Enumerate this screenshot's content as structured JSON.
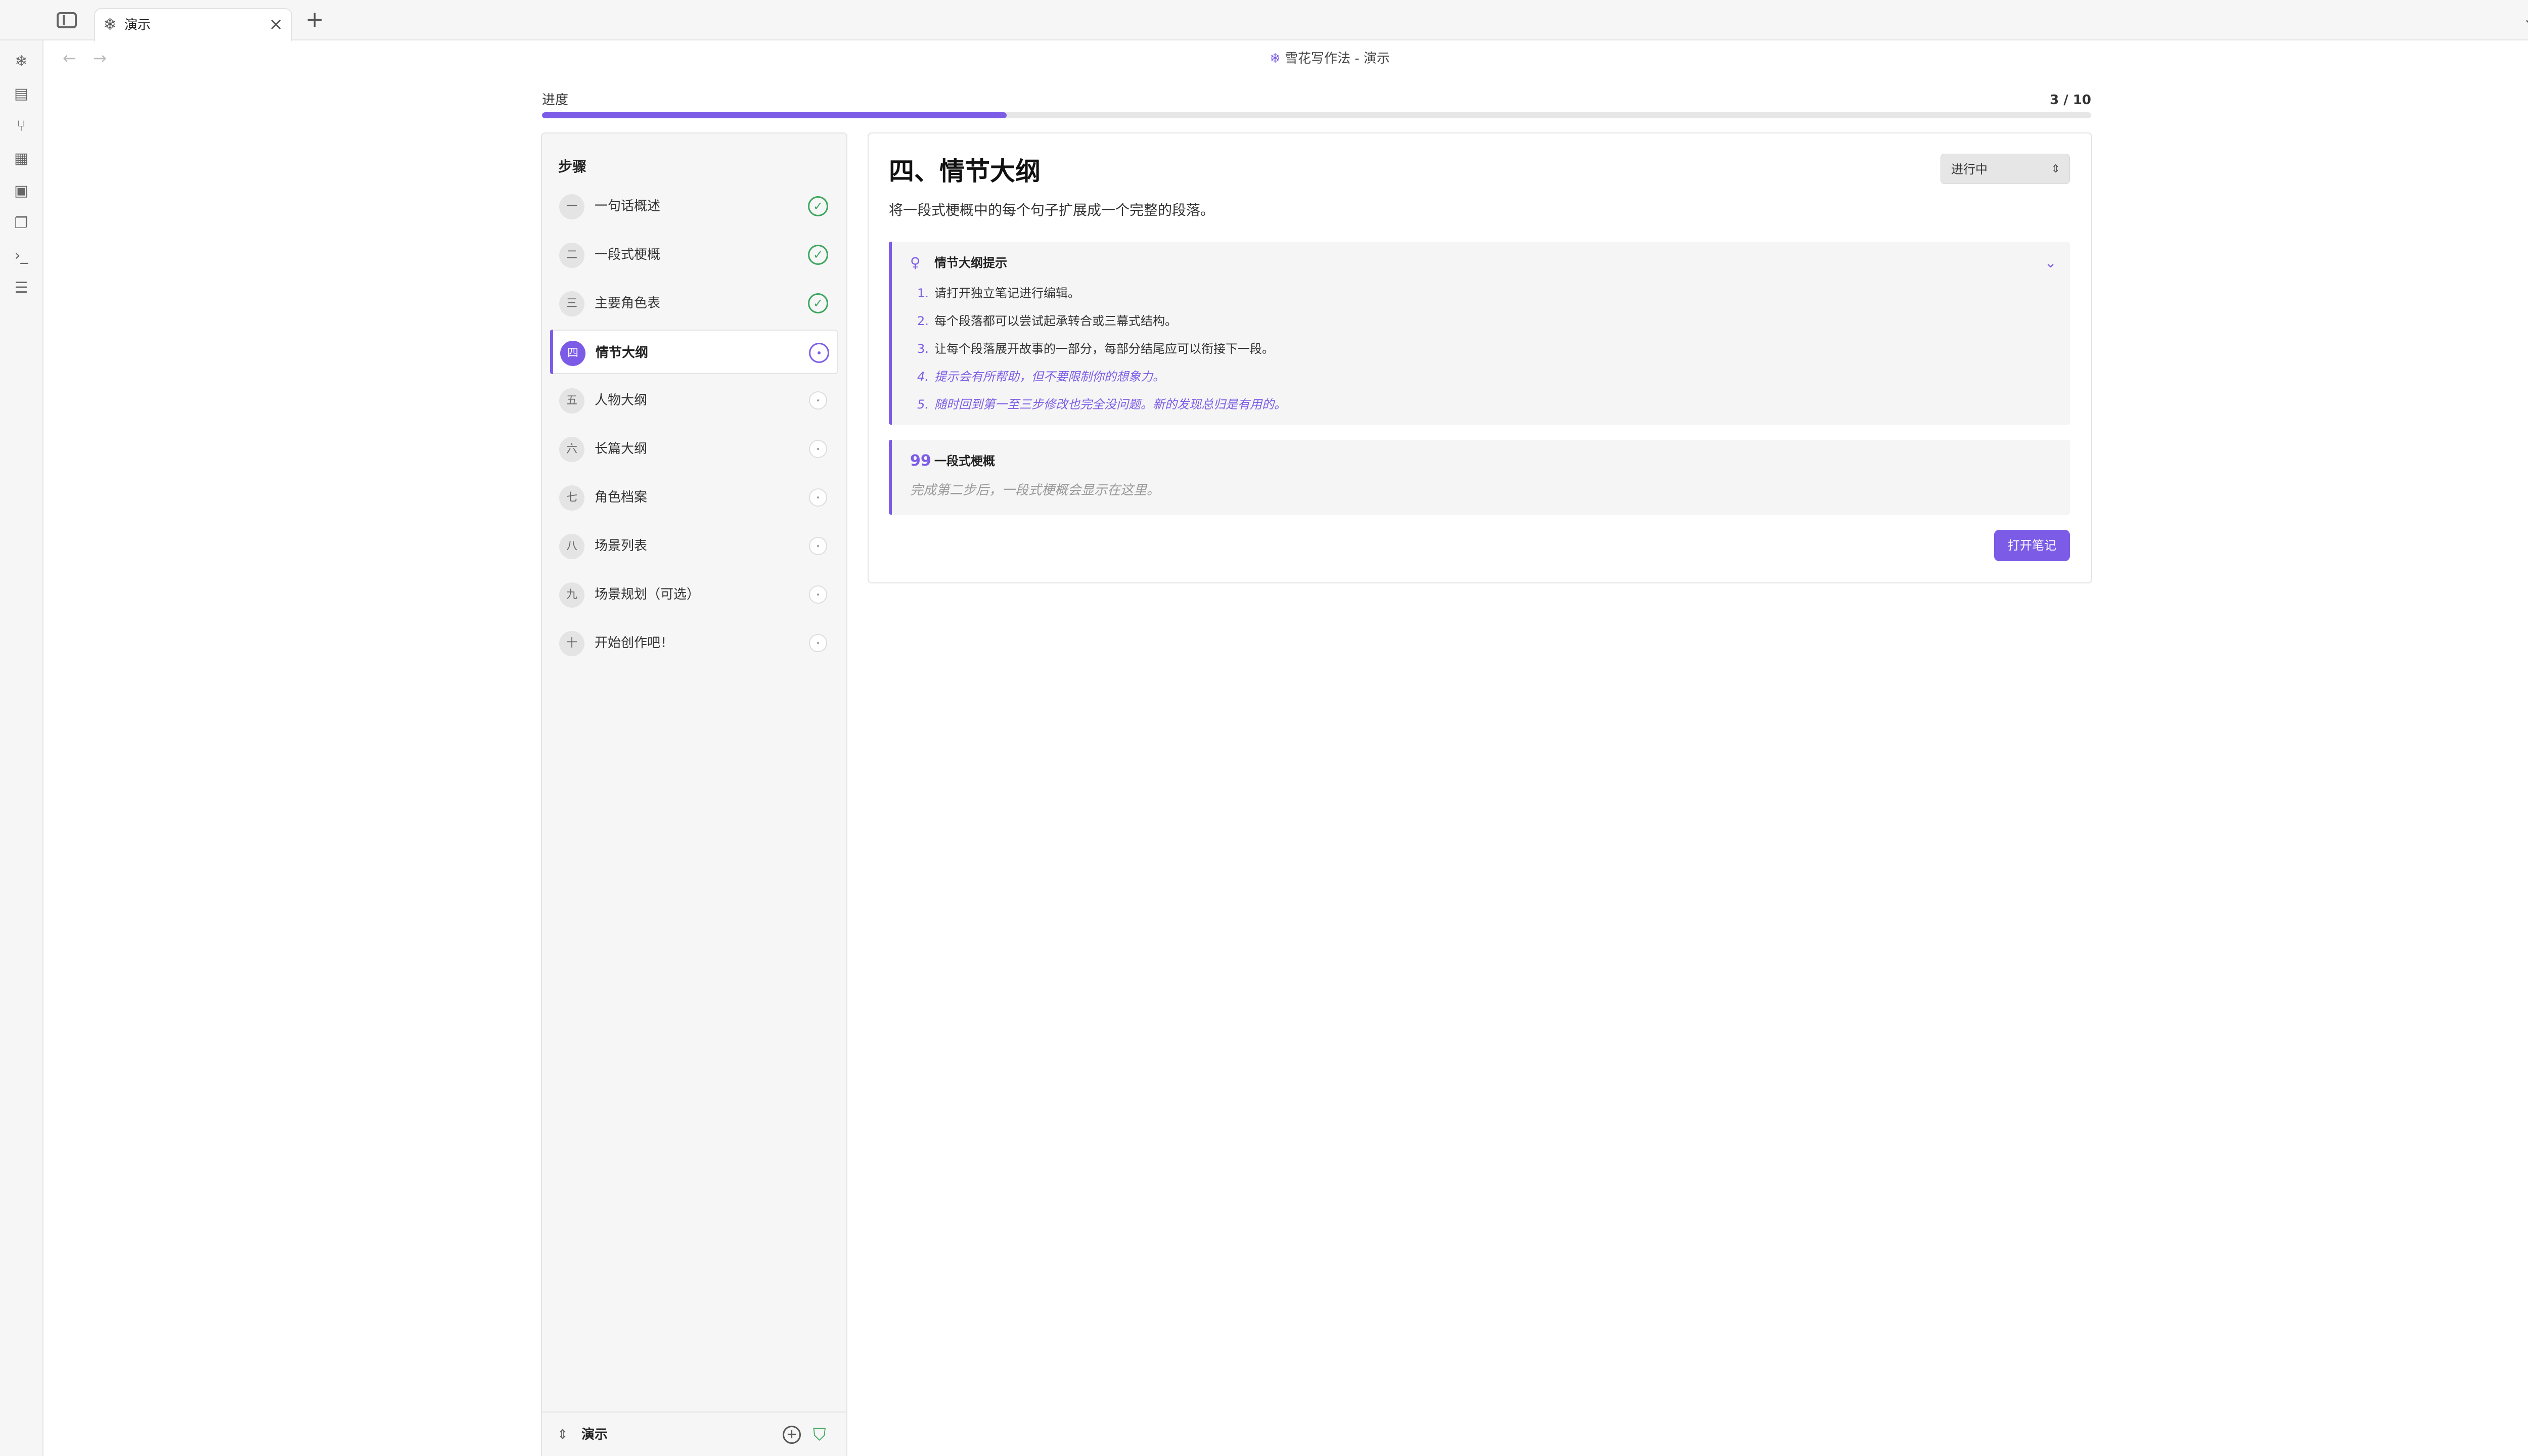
{
  "tabbar": {
    "tab_label": "演示",
    "new_tab_glyph": "+",
    "close_glyph": "×"
  },
  "view": {
    "title": "雪花写作法 - 演示"
  },
  "progress": {
    "label": "进度",
    "count": "3 / 10",
    "current": 3,
    "total": 10
  },
  "steps": {
    "title": "步骤",
    "items": [
      {
        "num": "一",
        "label": "一句话概述",
        "status": "done"
      },
      {
        "num": "二",
        "label": "一段式梗概",
        "status": "done"
      },
      {
        "num": "三",
        "label": "主要角色表",
        "status": "done"
      },
      {
        "num": "四",
        "label": "情节大纲",
        "status": "current"
      },
      {
        "num": "五",
        "label": "人物大纲",
        "status": "pending"
      },
      {
        "num": "六",
        "label": "长篇大纲",
        "status": "pending"
      },
      {
        "num": "七",
        "label": "角色档案",
        "status": "pending"
      },
      {
        "num": "八",
        "label": "场景列表",
        "status": "pending"
      },
      {
        "num": "九",
        "label": "场景规划（可选）",
        "status": "pending"
      },
      {
        "num": "十",
        "label": "开始创作吧！",
        "status": "pending"
      }
    ],
    "footer_label": "演示"
  },
  "main": {
    "heading": "四、情节大纲",
    "status_value": "进行中",
    "description": "将一段式梗概中的每个句子扩展成一个完整的段落。",
    "tips": {
      "title": "情节大纲提示",
      "items": [
        {
          "num": "1.",
          "text": "请打开独立笔记进行编辑。"
        },
        {
          "num": "2.",
          "text": "每个段落都可以尝试起承转合或三幕式结构。"
        },
        {
          "num": "3.",
          "text": "让每个段落展开故事的一部分，每部分结尾应可以衔接下一段。"
        },
        {
          "num": "4.",
          "text": "提示会有所帮助，但不要限制你的想象力。"
        },
        {
          "num": "5.",
          "text": "随时回到第一至三步修改也完全没问题。新的发现总归是有用的。"
        }
      ]
    },
    "quote": {
      "title": "一段式梗概",
      "placeholder": "完成第二步后，一段式梗概会显示在这里。"
    },
    "open_note_label": "打开笔记"
  },
  "icons": {
    "tab": "snowflake-icon",
    "accent_color": "#7c5ce6",
    "done_color": "#3aa65c"
  }
}
